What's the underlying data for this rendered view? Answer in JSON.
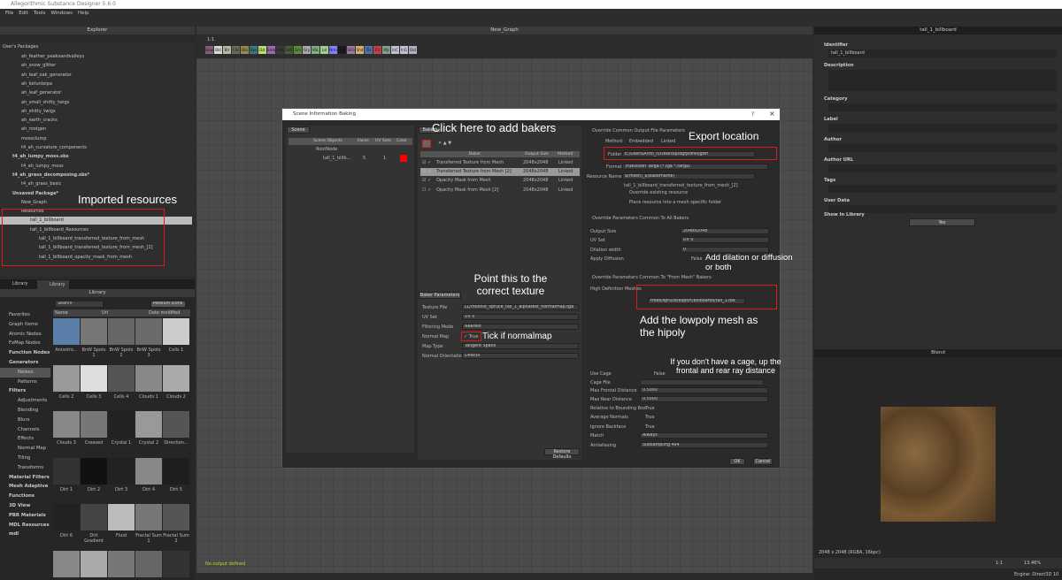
{
  "app": {
    "title": "Allegorithmic Substance Designer 5.6.0",
    "menu": [
      "File",
      "Edit",
      "Tools",
      "Windows",
      "Help"
    ]
  },
  "explorer": {
    "title": "Explorer",
    "section": "User's Packages",
    "items": [
      {
        "label": "ah_feather_peaksandvalleys",
        "indent": 1,
        "bold": false
      },
      {
        "label": "ah_snow_glitter",
        "indent": 1,
        "bold": false
      },
      {
        "label": "ah_leaf_oak_generator",
        "indent": 1,
        "bold": false
      },
      {
        "label": "ah_ketunleipa",
        "indent": 1,
        "bold": false
      },
      {
        "label": "ah_leaf_generator",
        "indent": 1,
        "bold": false
      },
      {
        "label": "ah_small_shitty_twigs",
        "indent": 1,
        "bold": false
      },
      {
        "label": "ah_shitty_twigs",
        "indent": 1,
        "bold": false
      },
      {
        "label": "ah_earth_cracks",
        "indent": 1,
        "bold": false
      },
      {
        "label": "ah_rootgen",
        "indent": 1,
        "bold": false
      },
      {
        "label": "mossclump",
        "indent": 1,
        "bold": false
      },
      {
        "label": "t4_ah_curvature_components",
        "indent": 1,
        "bold": false
      },
      {
        "label": "t4_ah_lumpy_moss.sbs",
        "indent": 0,
        "bold": true
      },
      {
        "label": "t4_ah_lumpy_moss",
        "indent": 1,
        "bold": false
      },
      {
        "label": "t4_ah_grass_decomposing.sbs*",
        "indent": 0,
        "bold": true
      },
      {
        "label": "t4_ah_grass_basic",
        "indent": 1,
        "bold": false
      },
      {
        "label": "Unsaved Package*",
        "indent": 0,
        "bold": true
      },
      {
        "label": "New_Graph",
        "indent": 1,
        "bold": false
      },
      {
        "label": "Resources",
        "indent": 1,
        "bold": false
      },
      {
        "label": "tall_1_billboard",
        "indent": 2,
        "bold": false,
        "selected": true
      },
      {
        "label": "tall_1_billboard_Resources",
        "indent": 2,
        "bold": false
      },
      {
        "label": "tall_1_billboard_transferred_texture_from_mesh",
        "indent": 3,
        "bold": false
      },
      {
        "label": "tall_1_billboard_transferred_texture_from_mesh_[2]",
        "indent": 3,
        "bold": false
      },
      {
        "label": "tall_1_billboard_opacity_mask_from_mesh",
        "indent": 3,
        "bold": false
      }
    ]
  },
  "library": {
    "tabs": [
      "Library",
      "Library"
    ],
    "title": "Library",
    "search_placeholder": "Search",
    "view_mode": "Medium Icons",
    "columns": [
      "Name",
      "Url",
      "Date modified"
    ],
    "sidebar": [
      {
        "label": "Favorites",
        "type": "item"
      },
      {
        "label": "Graph Items",
        "type": "item"
      },
      {
        "label": "Atomic Nodes",
        "type": "item"
      },
      {
        "label": "FxMap Nodes",
        "type": "item"
      },
      {
        "label": "Function Nodes",
        "type": "hdr"
      },
      {
        "label": "Generators",
        "type": "hdr"
      },
      {
        "label": "Noises",
        "type": "sub",
        "selected": true
      },
      {
        "label": "Patterns",
        "type": "sub"
      },
      {
        "label": "Filters",
        "type": "hdr"
      },
      {
        "label": "Adjustments",
        "type": "sub"
      },
      {
        "label": "Blending",
        "type": "sub"
      },
      {
        "label": "Blurs",
        "type": "sub"
      },
      {
        "label": "Channels",
        "type": "sub"
      },
      {
        "label": "Effects",
        "type": "sub"
      },
      {
        "label": "Normal Map",
        "type": "sub"
      },
      {
        "label": "Tiling",
        "type": "sub"
      },
      {
        "label": "Transforms",
        "type": "sub"
      },
      {
        "label": "Material Filters",
        "type": "hdr"
      },
      {
        "label": "Mesh Adaptive",
        "type": "hdr"
      },
      {
        "label": "Functions",
        "type": "hdr"
      },
      {
        "label": "3D View",
        "type": "hdr"
      },
      {
        "label": "PBR Materials",
        "type": "hdr"
      },
      {
        "label": "MDL Resources",
        "type": "hdr"
      },
      {
        "label": "mdl",
        "type": "hdr"
      }
    ],
    "tiles": [
      "Anisotro...",
      "BnW Spots 1",
      "BnW Spots 2",
      "BnW Spots 3",
      "Cells 1",
      "Cells 2",
      "Cells 3",
      "Cells 4",
      "Clouds 1",
      "Clouds 2",
      "Clouds 3",
      "Creased",
      "Crystal 1",
      "Crystal 2",
      "Direction...",
      "Dirt 1",
      "Dirt 2",
      "Dirt 3",
      "Dirt 4",
      "Dirt 5",
      "Dirt 6",
      "Dirt Gradient",
      "Fluid",
      "Fractal Sum 1",
      "Fractal Sum 2",
      "",
      "",
      "",
      "",
      ""
    ]
  },
  "graph": {
    "title": "New_Graph",
    "zoom_label": "1:1",
    "status": "No output defined",
    "palette": [
      {
        "t": "Gmp",
        "c": "#8a5a7a"
      },
      {
        "t": "Bld",
        "c": "#d8d8d8"
      },
      {
        "t": "Blr",
        "c": "#b8b8a0"
      },
      {
        "t": "Chs",
        "c": "#6a6a5a"
      },
      {
        "t": "Dbl",
        "c": "#9a8a50"
      },
      {
        "t": "Dyn",
        "c": "#3a7a7a"
      },
      {
        "t": "Dst",
        "c": "#b8e070"
      },
      {
        "t": "Emb",
        "c": "#9a6ab0"
      },
      {
        "t": "FxM",
        "c": "#3a3a3a"
      },
      {
        "t": "GrD",
        "c": "#4a5a3a"
      },
      {
        "t": "Grs",
        "c": "#5a8a3a"
      },
      {
        "t": "Gry",
        "c": "#a8a8a8"
      },
      {
        "t": "HSL",
        "c": "#80b080"
      },
      {
        "t": "Lvl",
        "c": "#a0d090"
      },
      {
        "t": "Nrm",
        "c": "#8080ff"
      },
      {
        "t": "Pix",
        "c": "#1a1a1a"
      },
      {
        "t": "SVG",
        "c": "#9a7aa0"
      },
      {
        "t": "Shd",
        "c": "#d0b070"
      },
      {
        "t": "Trs",
        "c": "#5070a0"
      },
      {
        "t": "Clr",
        "c": "#c04050"
      },
      {
        "t": "Xfp",
        "c": "#80a090"
      },
      {
        "t": "InC",
        "c": "#c0c0d0"
      },
      {
        "t": "InG",
        "c": "#c0c0d0"
      },
      {
        "t": "Out",
        "c": "#b0b0c0"
      }
    ]
  },
  "properties": {
    "title": "tall_1_billboard",
    "fields": [
      {
        "label": "Identifier",
        "value": "tall_1_billboard"
      },
      {
        "label": "Description",
        "value": ""
      },
      {
        "label": "Category",
        "value": ""
      },
      {
        "label": "Label",
        "value": ""
      },
      {
        "label": "Author",
        "value": ""
      },
      {
        "label": "Author URL",
        "value": ""
      },
      {
        "label": "Tags",
        "value": ""
      },
      {
        "label": "User Data",
        "value": ""
      }
    ],
    "show_in_library_label": "Show In Library",
    "show_in_library_value": "Yes"
  },
  "view2d": {
    "title": "Blend",
    "info": "2048 x 2048 (RGBA, 16bpc)",
    "ratio": "1:1",
    "zoom": "13.46%",
    "engine": "Engine: Direct3D 10"
  },
  "dialog": {
    "title": "Scene Information Baking",
    "help": "?",
    "close": "×",
    "scene": {
      "tab": "Scene",
      "columns": [
        "Scene Objects",
        "Faces",
        "UV Sets",
        "Color"
      ],
      "root": "RootNode",
      "object": {
        "name": "tall_1_billb...",
        "faces": "5",
        "uv_sets": "1",
        "color": "#ff0000"
      }
    },
    "bakers": {
      "tab": "Bakers",
      "columns": [
        "Baker",
        "Output Size",
        "Method"
      ],
      "rows": [
        {
          "name": "Transferred Texture from Mesh",
          "size": "2048x2048",
          "method": "Linked",
          "checked": true,
          "selected": false
        },
        {
          "name": "Transferred Texture from Mesh [2]",
          "size": "2048x2048",
          "method": "Linked",
          "checked": true,
          "selected": true
        },
        {
          "name": "Opacity Mask from Mesh",
          "size": "2048x2048",
          "method": "Linked",
          "checked": true,
          "selected": false
        },
        {
          "name": "Opacity Mask from Mesh [2]",
          "size": "2048x2048",
          "method": "Linked",
          "checked": false,
          "selected": false
        }
      ]
    },
    "baker_params": {
      "tab": "Baker Parameters",
      "texture_file_label": "Texture File",
      "texture_file": "LL/moonlit_spruce_tall_1_alphatest_normalmap.tga",
      "uv_set_label": "UV Set",
      "uv_set": "UV 0",
      "filtering_label": "Filtering Mode",
      "filtering": "Nearest",
      "normal_map_label": "Normal Map",
      "normal_map": "True",
      "map_type_label": "Map Type",
      "map_type": "Tangent Space",
      "orientation_label": "Normal Orientation",
      "orientation": "DirectX",
      "restore": "Restore Defaults"
    },
    "output": {
      "override_label": "Override Common Output File Parameters",
      "method_label": "Method:",
      "method_embedded": "Embedded",
      "method_linked": "Linked",
      "folder_label": "Folder:",
      "folder": "E:/Users/Antti_n/Desktop/dgfjkdhkljgdff",
      "format_label": "Format:",
      "format": "Truevision Targa (*.tga *.targa)",
      "resource_name_label": "Resource Name:",
      "resource_name": "$(mesh)_$(bakername)",
      "resource_preview": "tall_1_billboard_transferred_texture_from_mesh_[2]",
      "override_existing": "Override existing resource",
      "place_folder": "Place resource into a mesh specific folder"
    },
    "common": {
      "override_label": "Override Parameters Common To All Bakers",
      "output_size_label": "Output Size",
      "output_size": "2048x2048",
      "uv_set_label": "UV Set",
      "uv_set": "UV 0",
      "dilation_label": "Dilation width",
      "dilation": "0",
      "diffusion_label": "Apply Diffusion",
      "diffusion": "False"
    },
    "from_mesh": {
      "override_label": "Override Parameters Common To \"From Mesh\" Bakers",
      "hd_label": "High Definition Meshes",
      "hd_mesh": "trees/spruce/export/billboards/tall_1.fbx",
      "use_cage_label": "Use Cage",
      "use_cage": "False",
      "cage_file_label": "Cage File",
      "cage_file": "",
      "max_frontal_label": "Max Frontal Distance",
      "max_frontal": "0.5000",
      "max_rear_label": "Max Rear Distance",
      "max_rear": "0.5000",
      "relative_label": "Relative to Bounding Box",
      "relative": "True",
      "avg_normals_label": "Average Normals",
      "avg_normals": "True",
      "ignore_backface_label": "Ignore Backface",
      "ignore_backface": "True",
      "match_label": "Match",
      "match": "Always",
      "aa_label": "Antialiasing",
      "aa": "Subsampling 4x4"
    },
    "ok": "OK",
    "cancel": "Cancel"
  },
  "annotations": {
    "imported": "Imported resources",
    "add_bakers": "Click here to add bakers",
    "export": "Export location",
    "point_texture": "Point this to the correct texture",
    "tick_normal": "Tick if normalmap",
    "dilation": "Add dilation or diffusion or both",
    "lowpoly": "Add the lowpoly mesh as the hipoly",
    "cage": "If you don't have a cage, up the frontal and rear ray distance",
    "color": "#e01818"
  }
}
